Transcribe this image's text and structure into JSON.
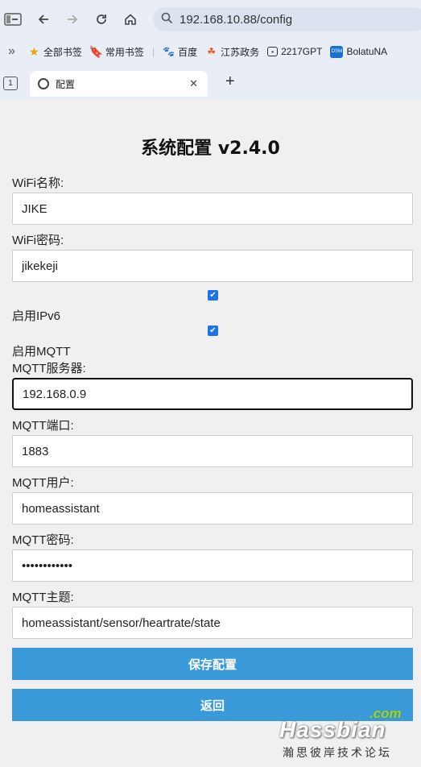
{
  "browser": {
    "url": "192.168.10.88/config",
    "bookmarks": [
      "全部书签",
      "常用书签",
      "百度",
      "江苏政务",
      "2217GPT",
      "BolatuNA"
    ],
    "tab_count": "1",
    "tab_title": "配置",
    "new_tab": "+"
  },
  "page": {
    "title": "系统配置 v2.4.0",
    "wifi_name_label": "WiFi名称:",
    "wifi_name_value": "JIKE",
    "wifi_pass_label": "WiFi密码:",
    "wifi_pass_value": "jikekeji",
    "ipv6_label": "启用IPv6",
    "ipv6_checked": true,
    "mqtt_enable_label": "启用MQTT",
    "mqtt_enable_checked": true,
    "mqtt_server_label": "MQTT服务器:",
    "mqtt_server_value": "192.168.0.9",
    "mqtt_port_label": "MQTT端口:",
    "mqtt_port_value": "1883",
    "mqtt_user_label": "MQTT用户:",
    "mqtt_user_value": "homeassistant",
    "mqtt_pass_label": "MQTT密码:",
    "mqtt_pass_value": "••••••••••••",
    "mqtt_topic_label": "MQTT主题:",
    "mqtt_topic_value": "homeassistant/sensor/heartrate/state",
    "save_button": "保存配置",
    "back_button": "返回"
  },
  "watermark": {
    "brand": "Hassbian",
    "domain": ".com",
    "tagline": "瀚思彼岸技术论坛"
  }
}
